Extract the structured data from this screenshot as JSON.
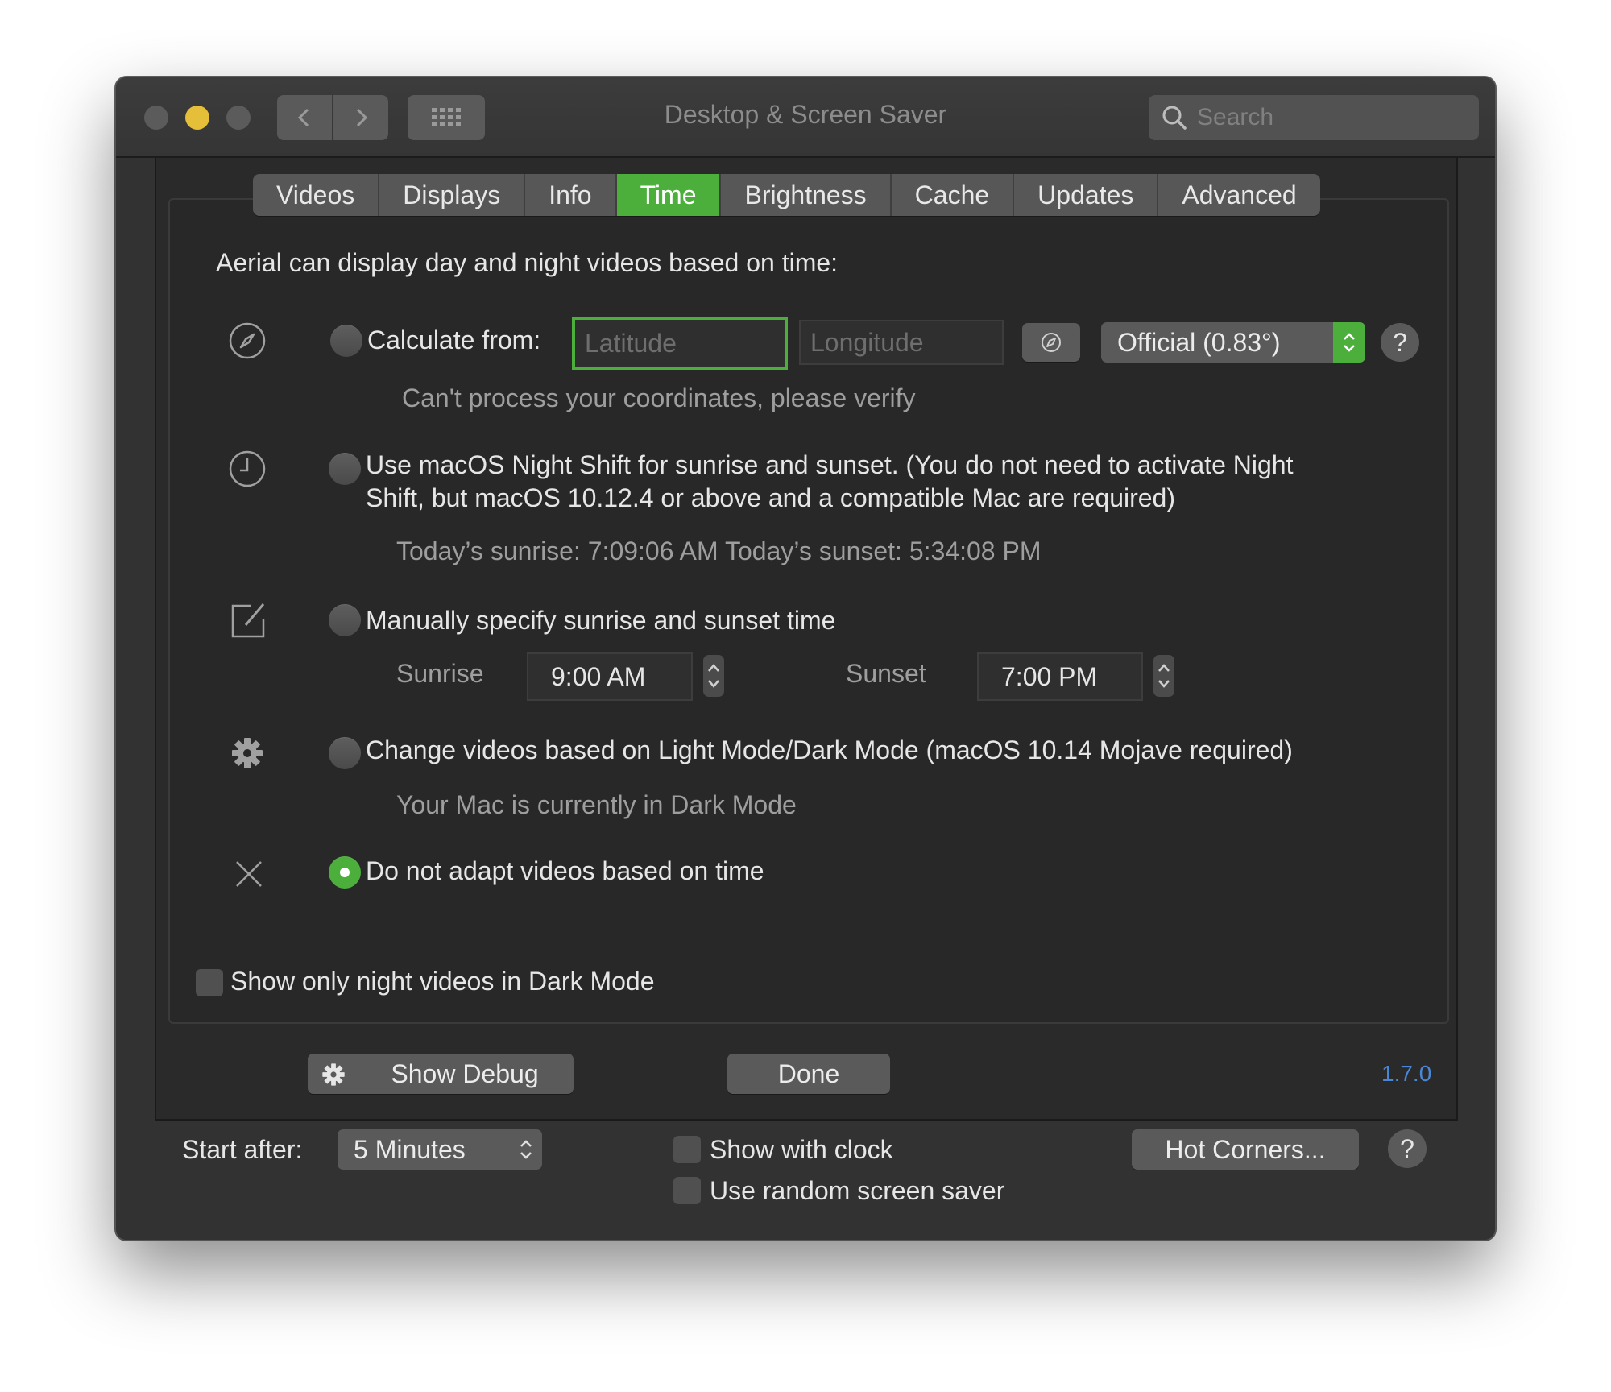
{
  "window": {
    "title": "Desktop & Screen Saver",
    "search_placeholder": "Search"
  },
  "tabs": [
    {
      "label": "Videos",
      "active": false
    },
    {
      "label": "Displays",
      "active": false
    },
    {
      "label": "Info",
      "active": false
    },
    {
      "label": "Time",
      "active": true
    },
    {
      "label": "Brightness",
      "active": false
    },
    {
      "label": "Cache",
      "active": false
    },
    {
      "label": "Updates",
      "active": false
    },
    {
      "label": "Advanced",
      "active": false
    }
  ],
  "time": {
    "intro": "Aerial can display day and night videos based on time:",
    "calculate": {
      "label": "Calculate from:",
      "latitude_placeholder": "Latitude",
      "longitude_placeholder": "Longitude",
      "mode": "Official (0.83°)",
      "error": "Can't process your coordinates, please verify"
    },
    "night_shift": {
      "label_line1": "Use macOS Night Shift for sunrise and sunset. (You do not need to activate Night",
      "label_line2": "Shift, but macOS 10.12.4 or above and a compatible Mac are required)",
      "info": "Today’s sunrise: 7:09:06 AM  Today’s sunset: 5:34:08 PM"
    },
    "manual": {
      "label": "Manually specify sunrise and sunset time",
      "sunrise_label": "Sunrise",
      "sunrise_value": "9:00 AM",
      "sunset_label": "Sunset",
      "sunset_value": "7:00 PM"
    },
    "dark_mode": {
      "label": "Change videos based on Light Mode/Dark Mode (macOS 10.14 Mojave required)",
      "info": "Your Mac is currently in Dark Mode"
    },
    "no_adapt": {
      "label": "Do not adapt videos based on time",
      "selected": true
    },
    "night_only_checkbox": "Show only night videos in Dark Mode"
  },
  "footer": {
    "debug_button": "Show Debug",
    "done_button": "Done",
    "version": "1.7.0"
  },
  "bottom": {
    "start_after_label": "Start after:",
    "start_after_value": "5 Minutes",
    "show_clock": "Show with clock",
    "random_saver": "Use random screen saver",
    "hot_corners": "Hot Corners...",
    "help": "?"
  },
  "help_glyph": "?",
  "colors": {
    "accent": "#4caf3c",
    "window_bg": "#323232",
    "version_link": "#4a87d6"
  }
}
